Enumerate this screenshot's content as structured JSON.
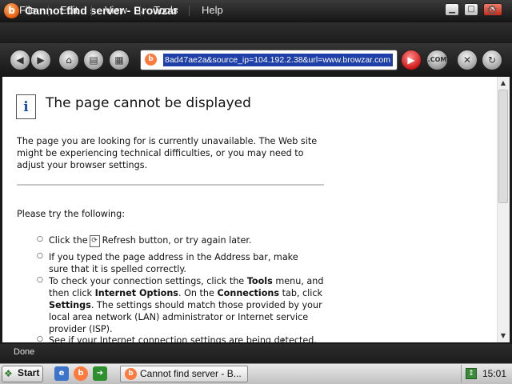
{
  "window": {
    "title": "Cannot find server - Browzar",
    "app_logo_letter": "b",
    "controls": {
      "minimize": "▁",
      "maximize": "□",
      "close": "✕"
    }
  },
  "menu": {
    "items": [
      "File",
      "Edit",
      "View",
      "Tools",
      "Help"
    ],
    "settings_icon": "gear-icon"
  },
  "toolbar": {
    "back_icon": "◀",
    "forward_icon": "▶",
    "home_icon": "⌂",
    "print_icon": "▤",
    "save_icon": "▦",
    "address_url": "8ad47ae2a&source_ip=104.192.2.38&url=www.browzar.com",
    "go_icon": "▶",
    "com_label": ".COM",
    "clear_icon": "✕",
    "refresh_icon": "↻"
  },
  "content": {
    "heading": "The page cannot be displayed",
    "intro": "The page you are looking for is currently unavailable. The Web site might be experiencing technical difficulties, or you may need to adjust your browser settings.",
    "try_heading": "Please try the following:",
    "bullets": {
      "b1_pre": "Click the",
      "b1_post": "Refresh button, or try again later.",
      "b2": "If you typed the page address in the Address bar, make sure that it is spelled correctly.",
      "b3_p1": "To check your connection settings, click the",
      "b3_tools": "Tools",
      "b3_p2": "menu, and then click",
      "b3_options": "Internet Options",
      "b3_p3": ". On the",
      "b3_connections": "Connections",
      "b3_p4": "tab, click",
      "b3_settings": "Settings",
      "b3_p5": ". The settings should match those provided by your local area network (LAN) administrator or Internet service provider (ISP).",
      "b4": "See if your Internet connection settings are being detected."
    }
  },
  "status": {
    "text": "Done"
  },
  "taskbar": {
    "start_label": "Start",
    "task_label": "Cannot find server - B...",
    "clock": "15:01"
  },
  "colors": {
    "address_highlight": "#1f3fa8",
    "go_button": "#cc1010",
    "brand": "#e8590c"
  }
}
